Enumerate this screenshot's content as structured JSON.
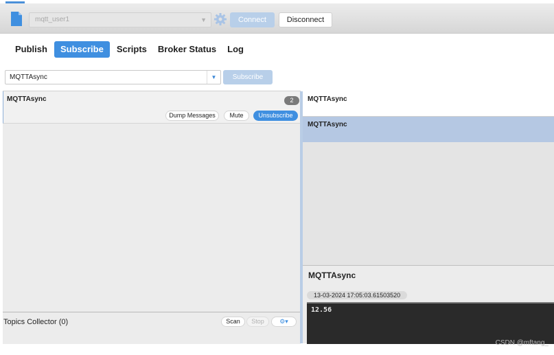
{
  "toolbar": {
    "profile_value": "mqtt_user1",
    "connect_label": "Connect",
    "disconnect_label": "Disconnect"
  },
  "tabs": [
    {
      "label": "Publish",
      "active": false
    },
    {
      "label": "Subscribe",
      "active": true
    },
    {
      "label": "Scripts",
      "active": false
    },
    {
      "label": "Broker Status",
      "active": false
    },
    {
      "label": "Log",
      "active": false
    }
  ],
  "subscribe_bar": {
    "topic_value": "MQTTAsync",
    "subscribe_label": "Subscribe"
  },
  "subscriptions": [
    {
      "topic": "MQTTAsync",
      "count": "2",
      "dump_label": "Dump Messages",
      "mute_label": "Mute",
      "unsubscribe_label": "Unsubscribe"
    }
  ],
  "topics_collector": {
    "title": "Topics Collector (0)",
    "scan_label": "Scan",
    "stop_label": "Stop"
  },
  "messages": [
    {
      "topic": "MQTTAsync",
      "selected": false
    },
    {
      "topic": "MQTTAsync",
      "selected": true
    }
  ],
  "message_detail": {
    "topic": "MQTTAsync",
    "timestamp": "13-03-2024  17:05:03.61503520",
    "payload": "12.56"
  },
  "watermark": "CSDN @mftang_",
  "colors": {
    "accent": "#3f8fe0",
    "disabled_button": "#b8cfe9",
    "selected_row": "#b5c8e3",
    "payload_bg": "#2a2a2a"
  },
  "icons": [
    "document-icon",
    "gear-icon",
    "chevron-down-icon",
    "settings-dropdown-icon"
  ]
}
